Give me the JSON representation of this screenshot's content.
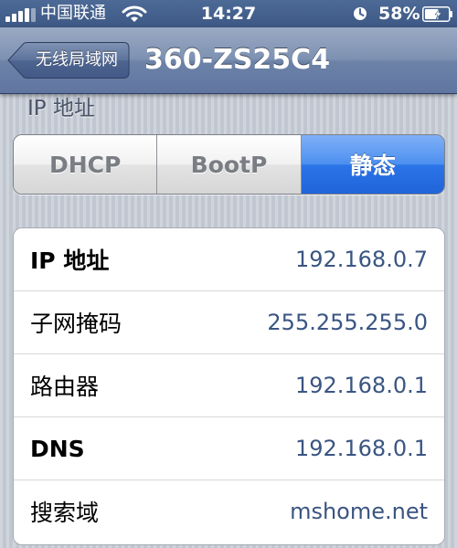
{
  "status_bar": {
    "carrier": "中国联通",
    "time": "14:27",
    "battery": "58%"
  },
  "nav": {
    "back_label": "无线局域网",
    "title": "360-ZS25C4"
  },
  "section": {
    "header": "IP 地址"
  },
  "segmented": {
    "options": [
      "DHCP",
      "BootP",
      "静态"
    ],
    "selected": "静态"
  },
  "rows": [
    {
      "label": "IP 地址",
      "value": "192.168.0.7"
    },
    {
      "label": "子网掩码",
      "value": "255.255.255.0"
    },
    {
      "label": "路由器",
      "value": "192.168.0.1"
    },
    {
      "label": "DNS",
      "value": "192.168.0.1"
    },
    {
      "label": "搜索域",
      "value": "mshome.net"
    }
  ],
  "colors": {
    "nav_bar": "#6c82a7",
    "selected_segment": "#2b74e8",
    "value_text": "#3a5582"
  },
  "icons": [
    "signal-strength-icon",
    "wifi-icon",
    "rotation-lock-icon",
    "battery-icon"
  ]
}
